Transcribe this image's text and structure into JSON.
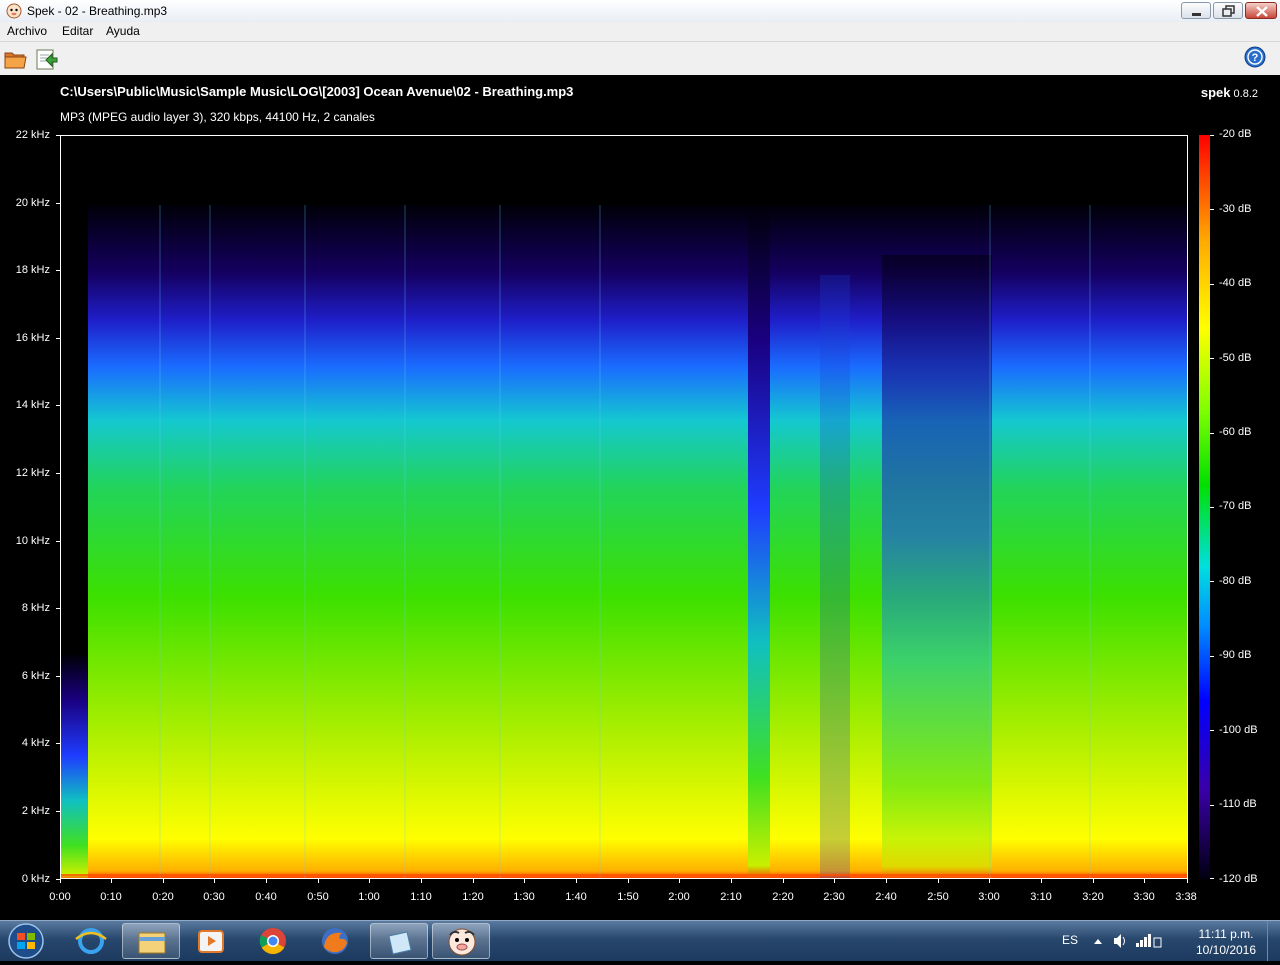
{
  "window": {
    "title": "Spek - 02 - Breathing.mp3",
    "icon": "spek-app-icon"
  },
  "menu": {
    "items": [
      "Archivo",
      "Editar",
      "Ayuda"
    ]
  },
  "toolbar": {
    "open_icon": "folder-open-icon",
    "save_icon": "save-export-icon",
    "help_icon": "help-icon"
  },
  "spectrogram": {
    "file_path": "C:\\Users\\Public\\Music\\Sample Music\\LOG\\[2003] Ocean Avenue\\02 - Breathing.mp3",
    "file_info": "MP3 (MPEG audio layer 3), 320 kbps, 44100 Hz, 2 canales",
    "brand_name": "spek",
    "brand_version": "0.8.2",
    "freq_labels": [
      "22 kHz",
      "20 kHz",
      "18 kHz",
      "16 kHz",
      "14 kHz",
      "12 kHz",
      "10 kHz",
      "8 kHz",
      "6 kHz",
      "4 kHz",
      "2 kHz",
      "0 kHz"
    ],
    "time_labels": [
      "0:00",
      "0:10",
      "0:20",
      "0:30",
      "0:40",
      "0:50",
      "1:00",
      "1:10",
      "1:20",
      "1:30",
      "1:40",
      "1:50",
      "2:00",
      "2:10",
      "2:20",
      "2:30",
      "2:40",
      "2:50",
      "3:00",
      "3:10",
      "3:20",
      "3:30",
      "3:38"
    ],
    "db_labels": [
      "-20 dB",
      "-30 dB",
      "-40 dB",
      "-50 dB",
      "-60 dB",
      "-70 dB",
      "-80 dB",
      "-90 dB",
      "-100 dB",
      "-110 dB",
      "-120 dB"
    ]
  },
  "taskbar": {
    "start_icon": "windows-start-icon",
    "items": [
      "internet-explorer-icon",
      "file-explorer-icon",
      "media-player-icon",
      "chrome-icon",
      "firefox-icon",
      "notepad-icon",
      "spek-app-icon"
    ],
    "language": "ES",
    "time": "11:11 p.m.",
    "date": "10/10/2016"
  }
}
